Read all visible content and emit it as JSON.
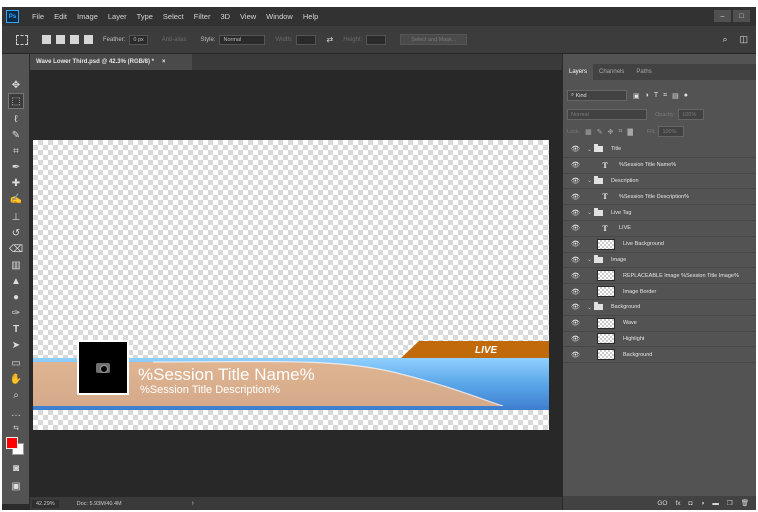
{
  "menubar": {
    "logo": "Ps",
    "items": [
      "File",
      "Edit",
      "Image",
      "Layer",
      "Type",
      "Select",
      "Filter",
      "3D",
      "View",
      "Window",
      "Help"
    ],
    "window_controls": [
      "–",
      "□"
    ]
  },
  "options": {
    "feather_label": "Feather:",
    "feather_value": "0 px",
    "antialias_label": "Anti-alias",
    "style_label": "Style:",
    "style_value": "Normal",
    "width_label": "Width:",
    "height_label": "Height:",
    "select_mask_label": "Select and Mask..."
  },
  "document": {
    "tab_title": "Wave Lower Third.psd @ 42.3% (RGB/8) *",
    "tab_close": "×"
  },
  "canvas": {
    "live_label": "LIVE",
    "session_title": "%Session Title Name%",
    "session_description": "%Session Title Description%",
    "colors": {
      "wave_peach": "#f0b07e",
      "wave_blue": "#5aa6e8",
      "wave_blue_dark": "#3f7fcf",
      "live_tag": "#c06a0c"
    }
  },
  "status": {
    "zoom": "42.29%",
    "doc_info": "Doc: 5.93M/40.4M",
    "arrow": "›"
  },
  "panel": {
    "tabs": [
      "Layers",
      "Channels",
      "Paths"
    ],
    "filter_kind": "Kind",
    "blend_mode": "Normal",
    "opacity_label": "Opacity:",
    "opacity_value": "100%",
    "lock_label": "Lock:",
    "fill_label": "Fill:",
    "fill_value": "100%"
  },
  "layers": [
    {
      "name": "Title",
      "kind": "group"
    },
    {
      "name": "%Session Title Name%",
      "kind": "text"
    },
    {
      "name": "Description",
      "kind": "group"
    },
    {
      "name": "%Session Title Description%",
      "kind": "text"
    },
    {
      "name": "Live Tag",
      "kind": "group"
    },
    {
      "name": "LIVE",
      "kind": "text"
    },
    {
      "name": "Live Background",
      "kind": "pixel"
    },
    {
      "name": "Image",
      "kind": "group"
    },
    {
      "name": "REPLACEABLE Image %Session Title Image%",
      "kind": "pixel"
    },
    {
      "name": "Image Border",
      "kind": "pixel"
    },
    {
      "name": "Background",
      "kind": "group"
    },
    {
      "name": "Wave",
      "kind": "pixel"
    },
    {
      "name": "Highlight",
      "kind": "pixel"
    },
    {
      "name": "Background",
      "kind": "pixel"
    }
  ],
  "panel_footer": [
    "GO",
    "fx",
    "◘",
    "◑",
    "▬",
    "❐",
    "🗑"
  ]
}
